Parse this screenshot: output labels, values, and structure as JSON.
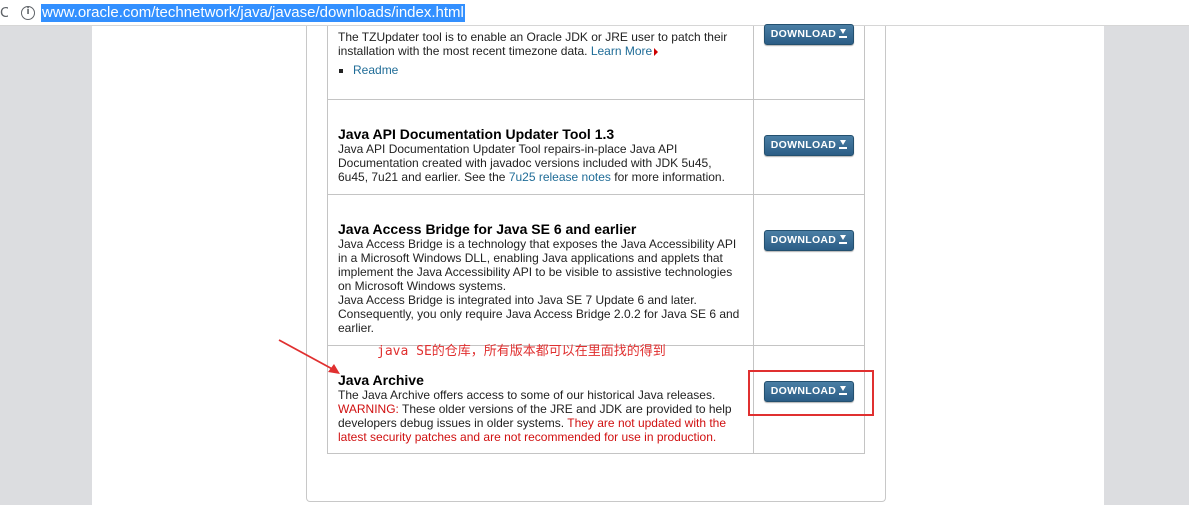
{
  "browser": {
    "url": "www.oracle.com/technetwork/java/javase/downloads/index.html"
  },
  "rows": [
    {
      "description_lines": [
        "The TZUpdater tool is to enable an Oracle JDK or JRE user to patch their",
        "installation with the most recent timezone data."
      ],
      "learn_more": "Learn More",
      "bullet_link": "Readme",
      "download_label": "DOWNLOAD"
    },
    {
      "title": "Java API Documentation Updater Tool 1.3",
      "description_lines": [
        "Java API Documentation Updater Tool repairs-in-place Java API",
        "Documentation created with javadoc versions included with JDK 5u45,"
      ],
      "line3_pre": "6u45, 7u21 and earlier.  See the",
      "line3_link": "7u25 release notes",
      "line3_post": "for more information.",
      "download_label": "DOWNLOAD"
    },
    {
      "title": "Java Access Bridge for Java SE 6 and earlier",
      "description_lines": [
        "Java Access Bridge is a technology that exposes the Java Accessibility API",
        "in a Microsoft Windows DLL, enabling Java applications and applets that",
        "implement the Java Accessibility API to be visible to assistive technologies",
        "on Microsoft Windows systems.",
        "Java Access Bridge is integrated into Java SE 7 Update 6 and later.",
        "Consequently, you only require Java Access Bridge 2.0.2 for Java SE 6 and",
        "earlier."
      ],
      "download_label": "DOWNLOAD"
    },
    {
      "title": "Java Archive",
      "description": "The Java Archive offers access to some of our historical Java releases.",
      "warning_label": "WARNING:",
      "warning_text_1": "These older versions of the JRE and JDK are provided to help",
      "warning_text_2": "developers debug issues in older systems.",
      "warning_red_2": "They are not updated with the",
      "warning_red_3": "latest security patches and are not recommended for use in production.",
      "download_label": "DOWNLOAD"
    }
  ],
  "annotation": {
    "text": "java SE的仓库，所有版本都可以在里面找的得到",
    "color": "#e03030"
  },
  "colors": {
    "link": "#1f6c97",
    "warning": "#d01010",
    "button": "#2b5d86",
    "gutter": "#dcdde0"
  }
}
